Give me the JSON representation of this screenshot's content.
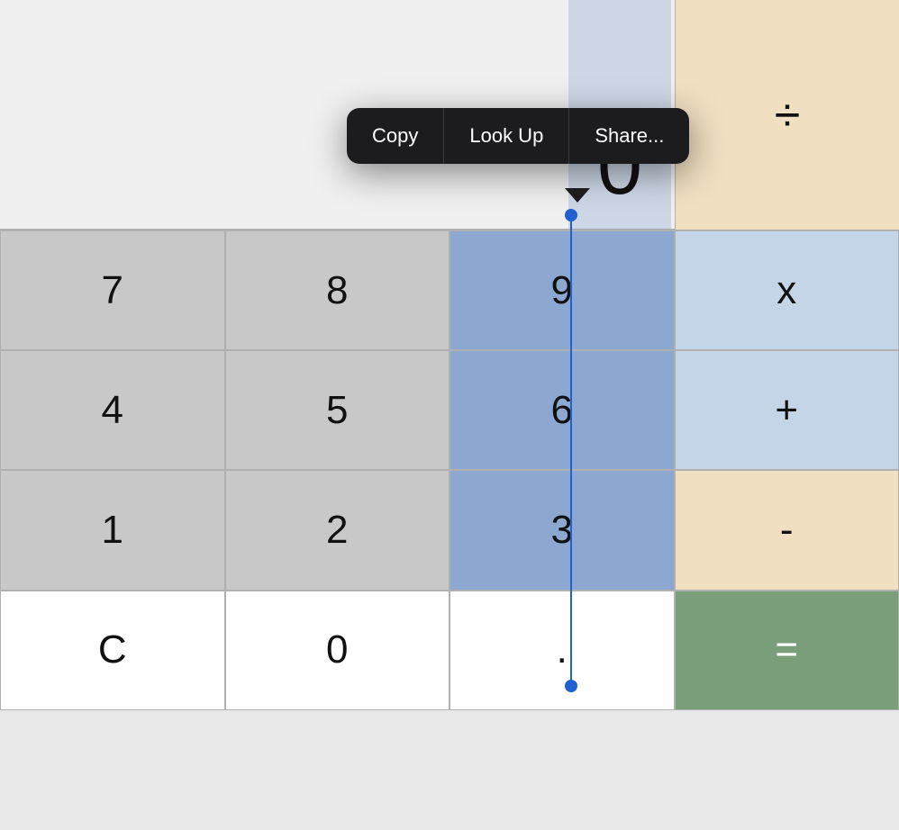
{
  "calculator": {
    "display": {
      "value": "0"
    },
    "context_menu": {
      "items": [
        {
          "id": "copy",
          "label": "Copy"
        },
        {
          "id": "look_up",
          "label": "Look Up"
        },
        {
          "id": "share",
          "label": "Share..."
        }
      ]
    },
    "keys": {
      "row1": [
        {
          "id": "7",
          "label": "7",
          "type": "number"
        },
        {
          "id": "8",
          "label": "8",
          "type": "number"
        },
        {
          "id": "9",
          "label": "9",
          "type": "number-highlighted"
        },
        {
          "id": "multiply",
          "label": "×",
          "type": "operator-blue"
        }
      ],
      "row2": [
        {
          "id": "4",
          "label": "4",
          "type": "number"
        },
        {
          "id": "5",
          "label": "5",
          "type": "number"
        },
        {
          "id": "6",
          "label": "6",
          "type": "number-highlighted"
        },
        {
          "id": "add",
          "label": "+",
          "type": "operator-blue"
        }
      ],
      "row3": [
        {
          "id": "1",
          "label": "1",
          "type": "number"
        },
        {
          "id": "2",
          "label": "2",
          "type": "number"
        },
        {
          "id": "3",
          "label": "3",
          "type": "number-highlighted"
        },
        {
          "id": "subtract",
          "label": "-",
          "type": "operator"
        }
      ],
      "row4": [
        {
          "id": "clear",
          "label": "C",
          "type": "special"
        },
        {
          "id": "0",
          "label": "0",
          "type": "special"
        },
        {
          "id": "decimal",
          "label": ".",
          "type": "special"
        },
        {
          "id": "equals",
          "label": "=",
          "type": "equals"
        }
      ],
      "row0": [
        {
          "id": "divide",
          "label": "÷",
          "type": "operator"
        }
      ]
    }
  }
}
